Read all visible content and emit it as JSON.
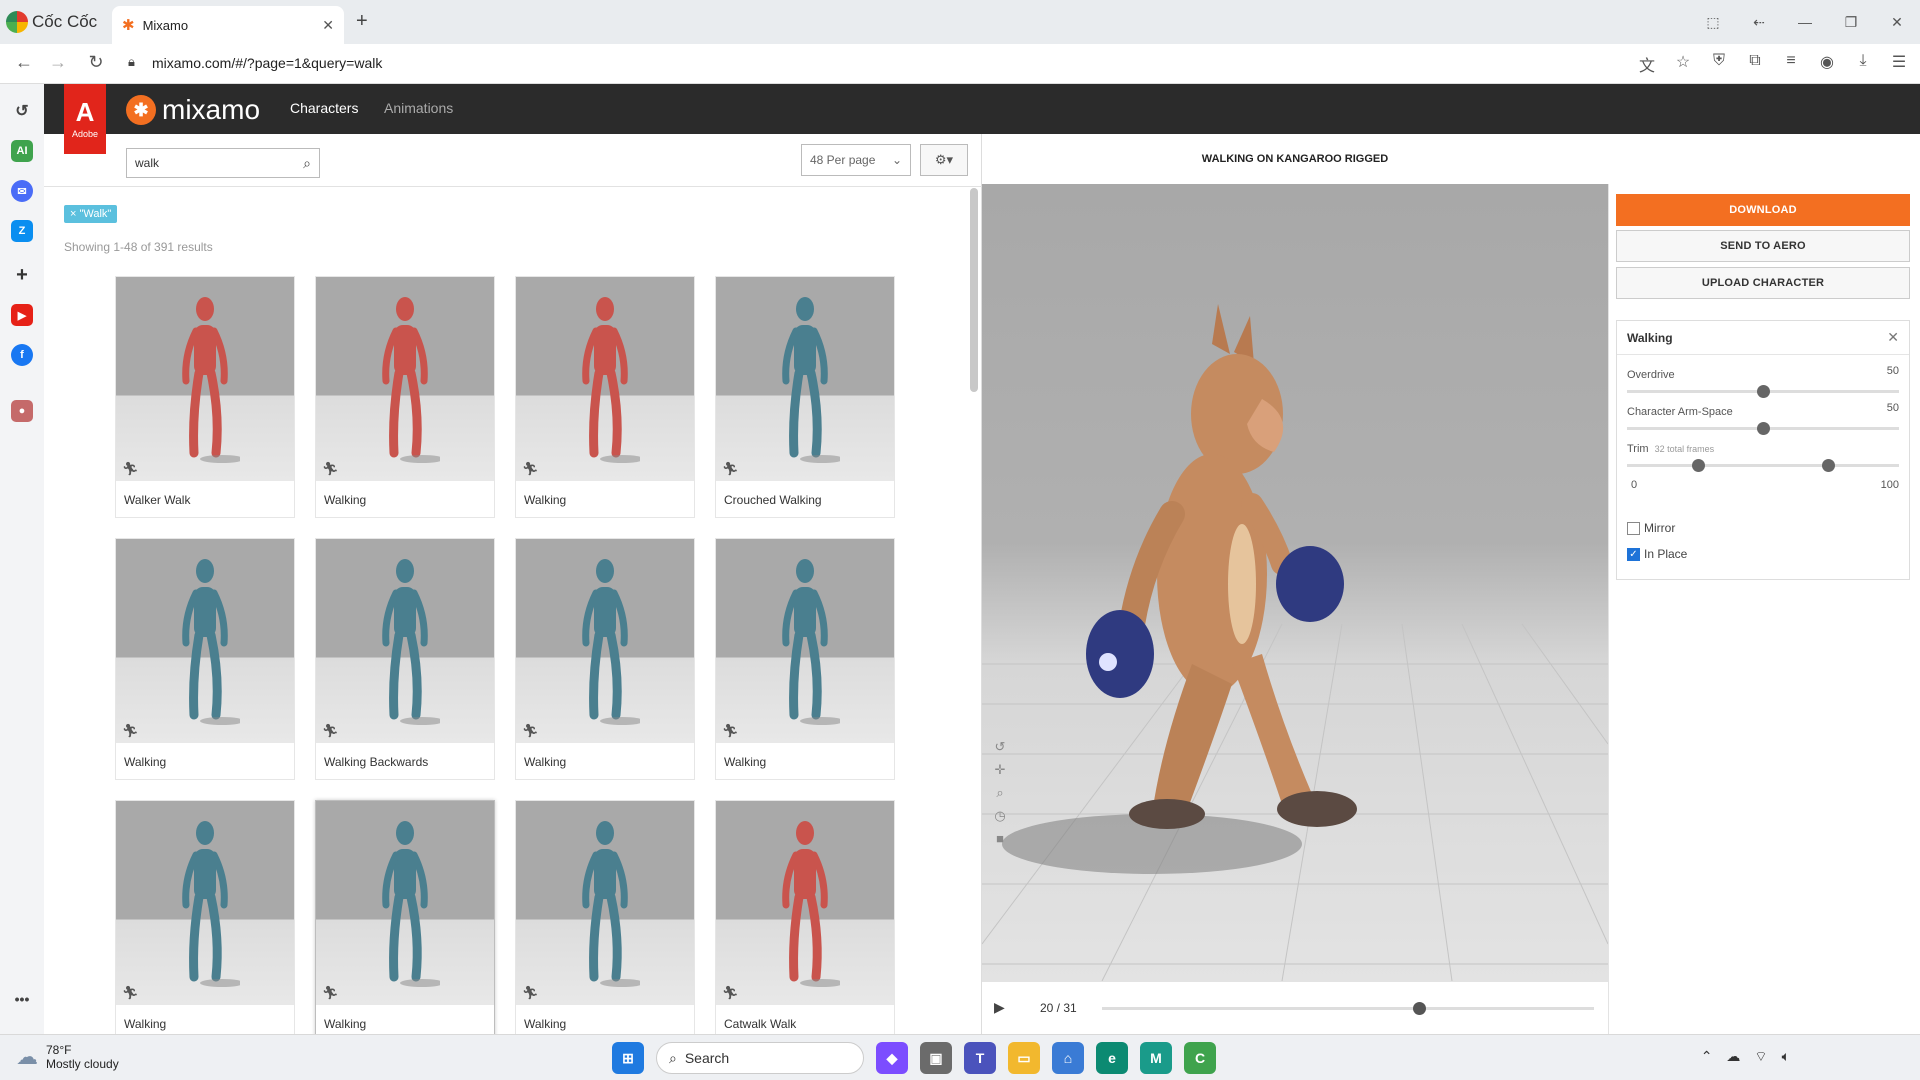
{
  "browser": {
    "brand": "Cốc Cốc",
    "tab_title": "Mixamo",
    "url": "mixamo.com/#/?page=1&query=walk"
  },
  "app": {
    "adobe_label": "Adobe",
    "logo_word": "mixamo",
    "nav": {
      "characters": "Characters",
      "animations": "Animations"
    }
  },
  "search": {
    "value": "walk",
    "placeholder": "Search"
  },
  "perpage": {
    "selected": "48 Per page"
  },
  "filter_tag": "× \"Walk\"",
  "results_text": "Showing 1-48 of 391 results",
  "cards": [
    {
      "label": "Walker Walk",
      "color": "#c9544d"
    },
    {
      "label": "Walking",
      "color": "#c9544d"
    },
    {
      "label": "Walking",
      "color": "#c9544d"
    },
    {
      "label": "Crouched Walking",
      "color": "#4a7f8f"
    },
    {
      "label": "Walking",
      "color": "#4a7f8f"
    },
    {
      "label": "Walking Backwards",
      "color": "#4a7f8f"
    },
    {
      "label": "Walking",
      "color": "#4a7f8f"
    },
    {
      "label": "Walking",
      "color": "#4a7f8f"
    },
    {
      "label": "Walking",
      "color": "#4a7f8f"
    },
    {
      "label": "Walking",
      "color": "#4a7f8f"
    },
    {
      "label": "Walking",
      "color": "#4a7f8f"
    },
    {
      "label": "Catwalk Walk",
      "color": "#c9544d"
    }
  ],
  "viewer": {
    "title": "WALKING ON KANGAROO RIGGED",
    "current_frame": "20",
    "frame_counter": "20 / 31",
    "playhead": 0.645
  },
  "actions": {
    "download": "DOWNLOAD",
    "send_to_aero": "SEND TO AERO",
    "upload_character": "UPLOAD CHARACTER"
  },
  "settings": {
    "title": "Walking",
    "overdrive": {
      "label": "Overdrive",
      "value": "50",
      "level": 0.5
    },
    "arm_space": {
      "label": "Character Arm-Space",
      "value": "50",
      "level": 0.5
    },
    "trim": {
      "label": "Trim",
      "sub": "32 total frames",
      "min": "0",
      "max": "100",
      "start": 0.26,
      "end": 0.74
    },
    "mirror": {
      "label": "Mirror",
      "checked": false
    },
    "in_place": {
      "label": "In Place",
      "checked": true
    }
  },
  "taskbar": {
    "temp": "78°F",
    "condition": "Mostly cloudy",
    "search": "Search"
  },
  "colors": {
    "accent": "#f36f21",
    "adobe_red": "#e1251b",
    "tag": "#5bc0de",
    "header": "#2b2b2b"
  }
}
